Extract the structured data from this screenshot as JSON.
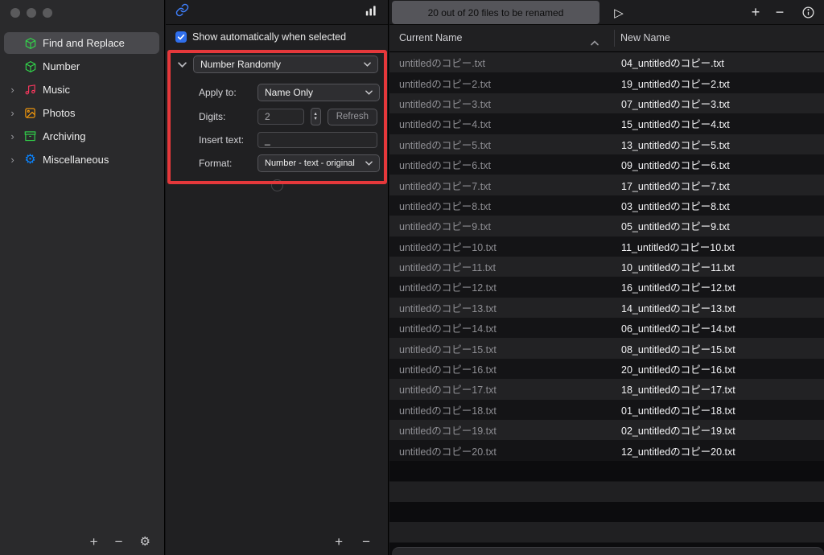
{
  "glyphs": {
    "plus": "+",
    "minus": "−",
    "play": "▷",
    "gear": "⚙",
    "chevron_right": "›",
    "stepper_up": "▴",
    "stepper_down": "▾"
  },
  "annotation": {
    "color": "#e5383b"
  },
  "sidebar": {
    "items": [
      {
        "label": "Find and Replace",
        "icon": "cube-icon",
        "color": "#32d74b",
        "selected": true,
        "expandable": false
      },
      {
        "label": "Number",
        "icon": "cube-icon",
        "color": "#32d74b",
        "selected": false,
        "expandable": false
      },
      {
        "label": "Music",
        "icon": "music-note-icon",
        "color": "#ff375f",
        "selected": false,
        "expandable": true
      },
      {
        "label": "Photos",
        "icon": "photo-icon",
        "color": "#ff9f0a",
        "selected": false,
        "expandable": true
      },
      {
        "label": "Archiving",
        "icon": "archive-icon",
        "color": "#32d74b",
        "selected": false,
        "expandable": true
      },
      {
        "label": "Miscellaneous",
        "icon": "gear-icon",
        "color": "#0a84ff",
        "selected": false,
        "expandable": true
      }
    ]
  },
  "inspector": {
    "show_when_selected": {
      "label": "Show automatically when selected",
      "checked": true
    },
    "action_type": "Number Randomly",
    "fields": {
      "apply_to": {
        "label": "Apply to:",
        "value": "Name Only"
      },
      "digits": {
        "label": "Digits:",
        "value": "2",
        "refresh_label": "Refresh"
      },
      "insert_text": {
        "label": "Insert text:",
        "value": "_"
      },
      "format": {
        "label": "Format:",
        "value": "Number - text - original"
      }
    }
  },
  "files": {
    "status": "20 out of 20 files to be renamed",
    "columns": {
      "current": "Current Name",
      "new": "New Name"
    },
    "rows": [
      {
        "current": "untitledのコピー.txt",
        "new": "04_untitledのコピー.txt"
      },
      {
        "current": "untitledのコピー2.txt",
        "new": "19_untitledのコピー2.txt"
      },
      {
        "current": "untitledのコピー3.txt",
        "new": "07_untitledのコピー3.txt"
      },
      {
        "current": "untitledのコピー4.txt",
        "new": "15_untitledのコピー4.txt"
      },
      {
        "current": "untitledのコピー5.txt",
        "new": "13_untitledのコピー5.txt"
      },
      {
        "current": "untitledのコピー6.txt",
        "new": "09_untitledのコピー6.txt"
      },
      {
        "current": "untitledのコピー7.txt",
        "new": "17_untitledのコピー7.txt"
      },
      {
        "current": "untitledのコピー8.txt",
        "new": "03_untitledのコピー8.txt"
      },
      {
        "current": "untitledのコピー9.txt",
        "new": "05_untitledのコピー9.txt"
      },
      {
        "current": "untitledのコピー10.txt",
        "new": "11_untitledのコピー10.txt"
      },
      {
        "current": "untitledのコピー11.txt",
        "new": "10_untitledのコピー11.txt"
      },
      {
        "current": "untitledのコピー12.txt",
        "new": "16_untitledのコピー12.txt"
      },
      {
        "current": "untitledのコピー13.txt",
        "new": "14_untitledのコピー13.txt"
      },
      {
        "current": "untitledのコピー14.txt",
        "new": "06_untitledのコピー14.txt"
      },
      {
        "current": "untitledのコピー15.txt",
        "new": "08_untitledのコピー15.txt"
      },
      {
        "current": "untitledのコピー16.txt",
        "new": "20_untitledのコピー16.txt"
      },
      {
        "current": "untitledのコピー17.txt",
        "new": "18_untitledのコピー17.txt"
      },
      {
        "current": "untitledのコピー18.txt",
        "new": "01_untitledのコピー18.txt"
      },
      {
        "current": "untitledのコピー19.txt",
        "new": "02_untitledのコピー19.txt"
      },
      {
        "current": "untitledのコピー20.txt",
        "new": "12_untitledのコピー20.txt"
      }
    ]
  }
}
